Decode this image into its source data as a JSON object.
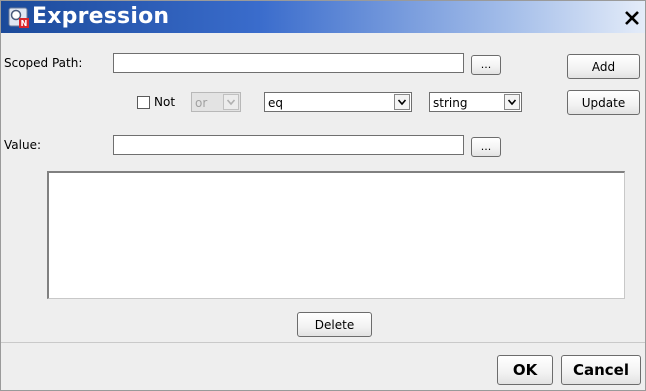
{
  "window": {
    "title": "Expression",
    "app_icon": "expression-app-icon",
    "close_icon": "close-icon"
  },
  "scoped_path": {
    "label": "Scoped Path:",
    "value": "",
    "browse_label": "..."
  },
  "condition": {
    "not_label": "Not",
    "not_checked": false,
    "conjunction_value": "or",
    "conjunction_enabled": false,
    "operator_value": "eq",
    "type_value": "string"
  },
  "value_field": {
    "label": "Value:",
    "value": "",
    "browse_label": "..."
  },
  "side_buttons": {
    "add_label": "Add",
    "update_label": "Update"
  },
  "expression_list": {
    "items": []
  },
  "delete_label": "Delete",
  "footer": {
    "ok_label": "OK",
    "cancel_label": "Cancel"
  },
  "colors": {
    "titlebar_start": "#1b4a9a",
    "titlebar_end": "#e4ecf9",
    "window_background": "#eeeeee"
  }
}
